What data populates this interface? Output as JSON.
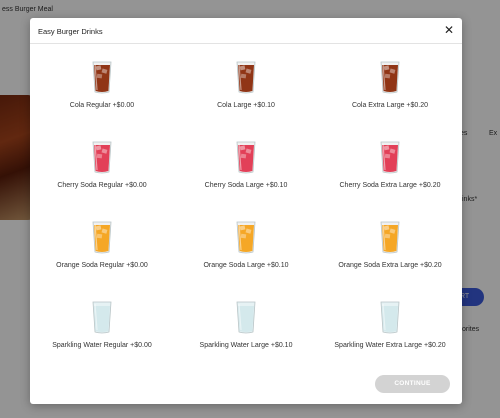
{
  "background": {
    "title": "ess Burger Meal",
    "right_texts": [
      "Ex",
      "es",
      "inks*",
      "orites",
      "RT"
    ]
  },
  "modal": {
    "title": "Easy Burger Drinks",
    "close_icon": "close-icon",
    "continue_label": "CONTINUE",
    "items": [
      {
        "label": "Cola Regular +$0.00",
        "drink": "cola",
        "color": "#8a2a0a"
      },
      {
        "label": "Cola Large +$0.10",
        "drink": "cola",
        "color": "#8a2a0a"
      },
      {
        "label": "Cola Extra Large +$0.20",
        "drink": "cola",
        "color": "#8a2a0a"
      },
      {
        "label": "Cherry Soda Regular +$0.00",
        "drink": "cherry",
        "color": "#e0364f"
      },
      {
        "label": "Cherry Soda Large +$0.10",
        "drink": "cherry",
        "color": "#e0364f"
      },
      {
        "label": "Cherry Soda Extra Large +$0.20",
        "drink": "cherry",
        "color": "#e0364f"
      },
      {
        "label": "Orange Soda Regular +$0.00",
        "drink": "orange",
        "color": "#f4a21a"
      },
      {
        "label": "Orange Soda Large +$0.10",
        "drink": "orange",
        "color": "#f4a21a"
      },
      {
        "label": "Orange Soda Extra Large +$0.20",
        "drink": "orange",
        "color": "#f4a21a"
      },
      {
        "label": "Sparkling Water Regular +$0.00",
        "drink": "water",
        "color": "#cfe6ea"
      },
      {
        "label": "Sparkling Water Large +$0.10",
        "drink": "water",
        "color": "#cfe6ea"
      },
      {
        "label": "Sparkling Water Extra Large +$0.20",
        "drink": "water",
        "color": "#cfe6ea"
      }
    ]
  }
}
